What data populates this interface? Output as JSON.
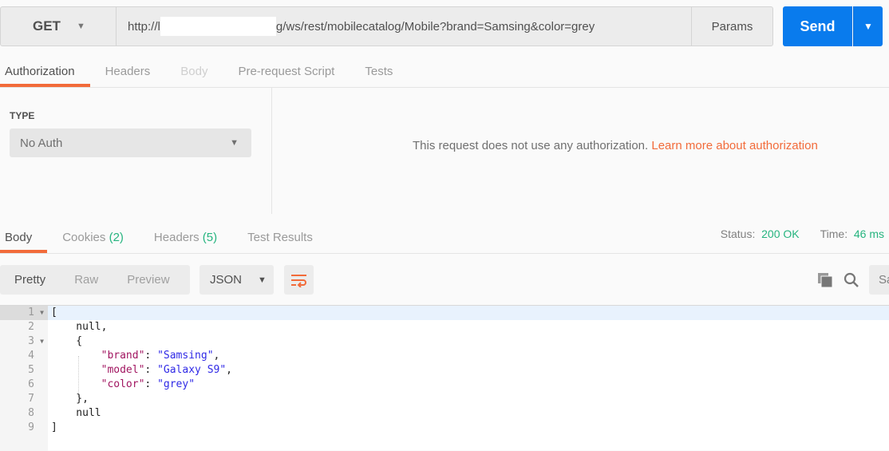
{
  "request": {
    "method": "GET",
    "url_prefix": "http://l",
    "url_suffix": "g/ws/rest/mobilecatalog/Mobile?brand=Samsing&color=grey",
    "params_label": "Params",
    "send_label": "Send"
  },
  "request_tabs": [
    {
      "label": "Authorization"
    },
    {
      "label": "Headers"
    },
    {
      "label": "Body"
    },
    {
      "label": "Pre-request Script"
    },
    {
      "label": "Tests"
    }
  ],
  "auth": {
    "type_label": "TYPE",
    "type_value": "No Auth",
    "message": "This request does not use any authorization.",
    "link": "Learn more about authorization"
  },
  "response_tabs": [
    {
      "label": "Body"
    },
    {
      "label": "Cookies",
      "count": "(2)"
    },
    {
      "label": "Headers",
      "count": "(5)"
    },
    {
      "label": "Test Results"
    }
  ],
  "status": {
    "status_label": "Status:",
    "status_value": "200 OK",
    "time_label": "Time:",
    "time_value": "46 ms"
  },
  "view_modes": [
    "Pretty",
    "Raw",
    "Preview"
  ],
  "format": "JSON",
  "save_label": "Sa",
  "colors": {
    "accent": "#f26b3a",
    "send": "#097bed",
    "success": "#26b47f",
    "json_key": "#a11560",
    "json_string": "#2f29e6"
  },
  "code": [
    {
      "n": "1",
      "fold": true,
      "parts": [
        [
          "p",
          "["
        ]
      ]
    },
    {
      "n": "2",
      "parts": [
        [
          "p",
          "    null,"
        ]
      ]
    },
    {
      "n": "3",
      "fold": true,
      "parts": [
        [
          "p",
          "    {"
        ]
      ]
    },
    {
      "n": "4",
      "parts": [
        [
          "p",
          "        "
        ],
        [
          "k",
          "\"brand\""
        ],
        [
          "p",
          ": "
        ],
        [
          "s",
          "\"Samsing\""
        ],
        [
          "p",
          ","
        ]
      ]
    },
    {
      "n": "5",
      "parts": [
        [
          "p",
          "        "
        ],
        [
          "k",
          "\"model\""
        ],
        [
          "p",
          ": "
        ],
        [
          "s",
          "\"Galaxy S9\""
        ],
        [
          "p",
          ","
        ]
      ]
    },
    {
      "n": "6",
      "parts": [
        [
          "p",
          "        "
        ],
        [
          "k",
          "\"color\""
        ],
        [
          "p",
          ": "
        ],
        [
          "s",
          "\"grey\""
        ]
      ]
    },
    {
      "n": "7",
      "parts": [
        [
          "p",
          "    },"
        ]
      ]
    },
    {
      "n": "8",
      "parts": [
        [
          "p",
          "    null"
        ]
      ]
    },
    {
      "n": "9",
      "parts": [
        [
          "p",
          "]"
        ]
      ]
    }
  ]
}
